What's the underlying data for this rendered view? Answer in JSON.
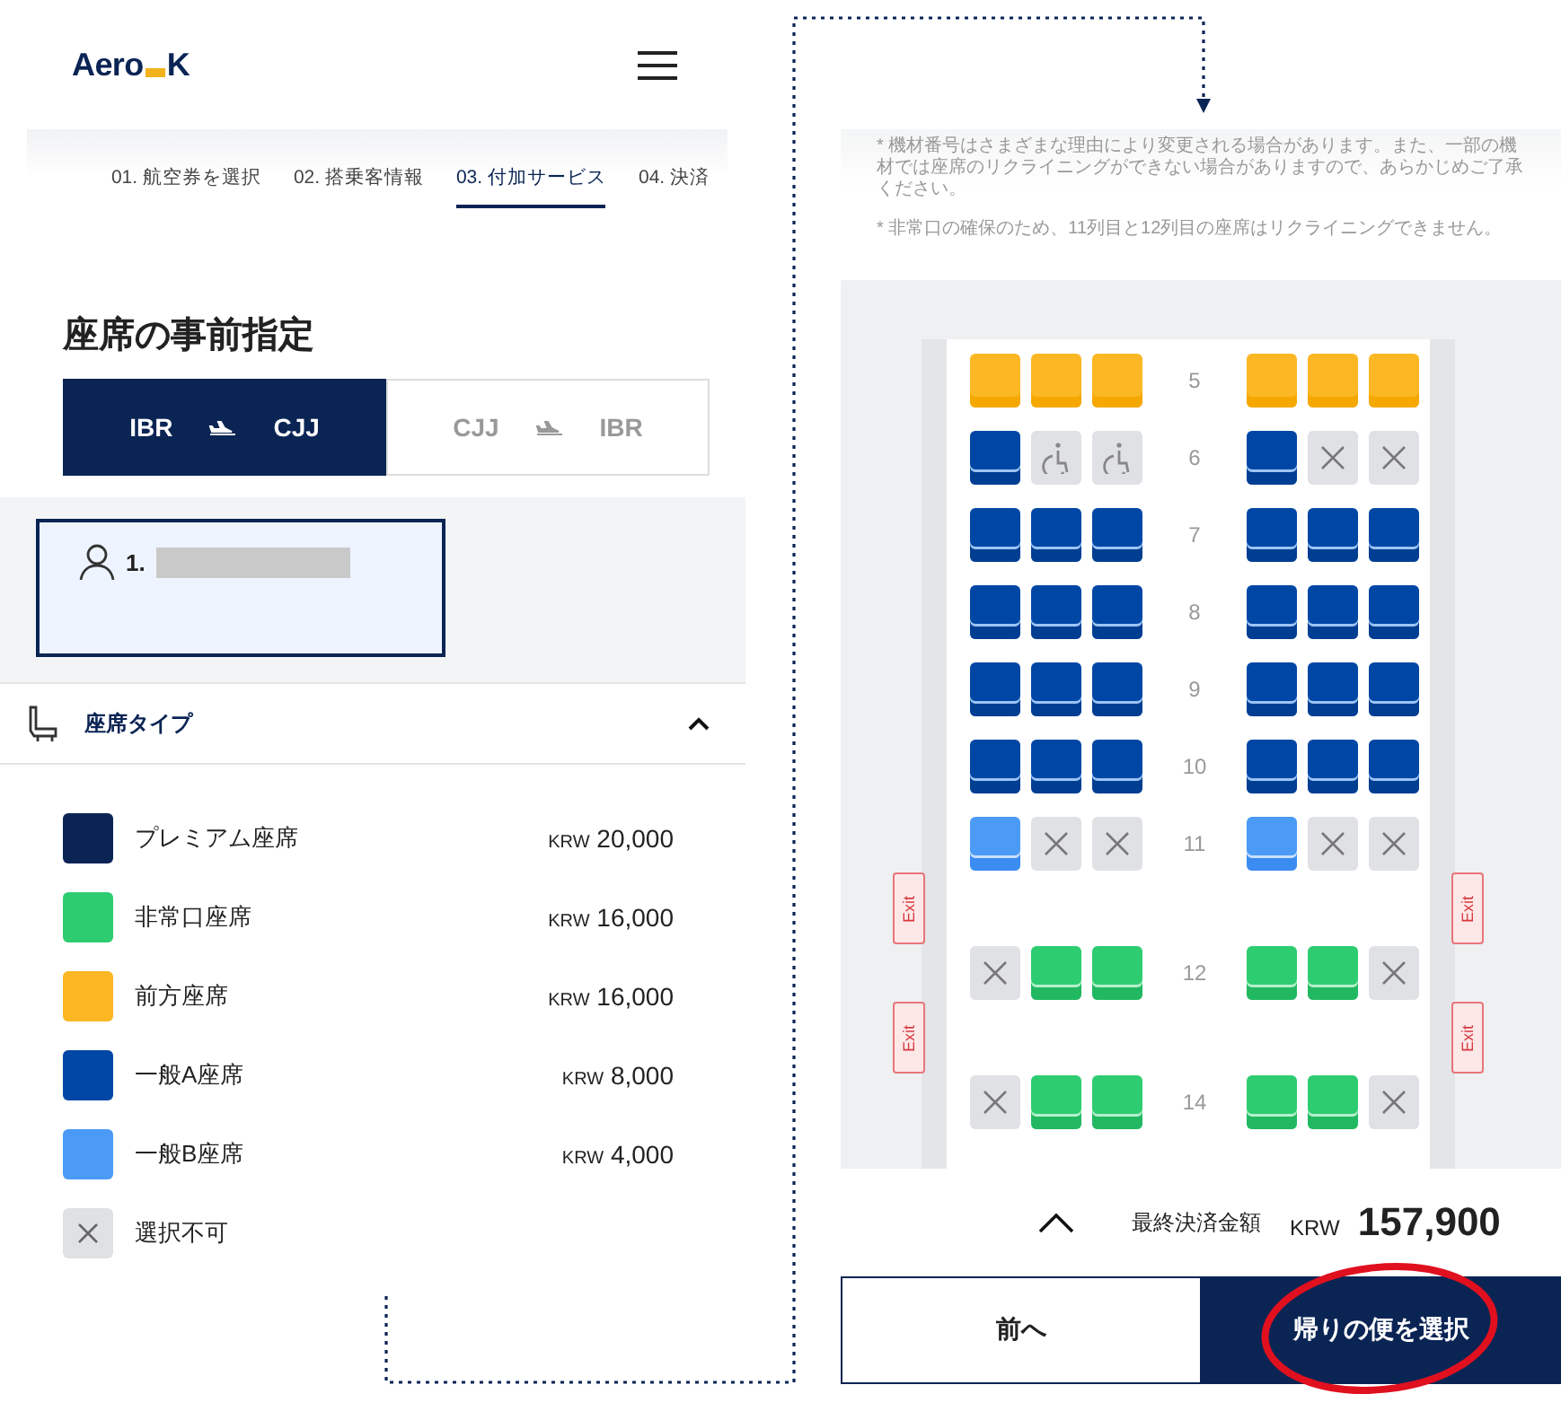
{
  "header": {
    "logo_left": "Aero",
    "logo_right": "K"
  },
  "steps": [
    {
      "label": "01. 航空券を選択",
      "selected": false
    },
    {
      "label": "02. 搭乗客情報",
      "selected": false
    },
    {
      "label": "03. 付加サービス",
      "selected": true
    },
    {
      "label": "04. 決済",
      "selected": false
    }
  ],
  "title": "座席の事前指定",
  "routes": [
    {
      "from": "IBR",
      "to": "CJJ",
      "selected": true
    },
    {
      "from": "CJJ",
      "to": "IBR",
      "selected": false
    }
  ],
  "passenger": {
    "label": "1.",
    "selected": true
  },
  "seat_type_section": {
    "title": "座席タイプ",
    "expanded": true
  },
  "legend": [
    {
      "kind": "seat",
      "color": "#0a2454",
      "label": "プレミアム座席",
      "currency": "KRW",
      "price": "20,000"
    },
    {
      "kind": "seat",
      "color": "#2ecc71",
      "label": "非常口座席",
      "currency": "KRW",
      "price": "16,000"
    },
    {
      "kind": "seat",
      "color": "#fbb724",
      "label": "前方座席",
      "currency": "KRW",
      "price": "16,000"
    },
    {
      "kind": "seat",
      "color": "#0047a5",
      "label": "一般A座席",
      "currency": "KRW",
      "price": "8,000"
    },
    {
      "kind": "seat",
      "color": "#4b9bf6",
      "label": "一般B座席",
      "currency": "KRW",
      "price": "4,000"
    },
    {
      "kind": "unavailable",
      "color": "#dfe1e5",
      "label": "選択不可"
    }
  ],
  "notes": [
    "* 機材番号はさまざまな理由により変更される場合があります。また、一部の機材では座席のリクライニングができない場合がありますので、あらかじめご了承ください。",
    "* 非常口の確保のため、11列目と12列目の座席はリクライニングできません。"
  ],
  "seat_rows": [
    {
      "kind": "seats",
      "label": "5",
      "seats": [
        {
          "kind": "front"
        },
        {
          "kind": "front"
        },
        {
          "kind": "front"
        },
        {
          "kind": "front"
        },
        {
          "kind": "front"
        },
        {
          "kind": "front"
        }
      ]
    },
    {
      "kind": "seats",
      "label": "6",
      "seats": [
        {
          "kind": "a"
        },
        {
          "kind": "wheelchair"
        },
        {
          "kind": "wheelchair"
        },
        {
          "kind": "a"
        },
        {
          "kind": "none"
        },
        {
          "kind": "none"
        }
      ]
    },
    {
      "kind": "seats",
      "label": "7",
      "seats": [
        {
          "kind": "a"
        },
        {
          "kind": "a"
        },
        {
          "kind": "a"
        },
        {
          "kind": "a"
        },
        {
          "kind": "a"
        },
        {
          "kind": "a"
        }
      ]
    },
    {
      "kind": "seats",
      "label": "8",
      "seats": [
        {
          "kind": "a"
        },
        {
          "kind": "a"
        },
        {
          "kind": "a"
        },
        {
          "kind": "a"
        },
        {
          "kind": "a"
        },
        {
          "kind": "a"
        }
      ]
    },
    {
      "kind": "seats",
      "label": "9",
      "seats": [
        {
          "kind": "a"
        },
        {
          "kind": "a"
        },
        {
          "kind": "a"
        },
        {
          "kind": "a"
        },
        {
          "kind": "a"
        },
        {
          "kind": "a"
        }
      ]
    },
    {
      "kind": "seats",
      "label": "10",
      "seats": [
        {
          "kind": "a"
        },
        {
          "kind": "a"
        },
        {
          "kind": "a"
        },
        {
          "kind": "a"
        },
        {
          "kind": "a"
        },
        {
          "kind": "a"
        }
      ]
    },
    {
      "kind": "seats",
      "label": "11",
      "seats": [
        {
          "kind": "b"
        },
        {
          "kind": "none"
        },
        {
          "kind": "none"
        },
        {
          "kind": "b"
        },
        {
          "kind": "none"
        },
        {
          "kind": "none"
        }
      ]
    },
    {
      "kind": "exit",
      "left": "Exit",
      "right": "Exit"
    },
    {
      "kind": "seats",
      "label": "12",
      "seats": [
        {
          "kind": "none"
        },
        {
          "kind": "exit"
        },
        {
          "kind": "exit"
        },
        {
          "kind": "exit"
        },
        {
          "kind": "exit"
        },
        {
          "kind": "none"
        }
      ]
    },
    {
      "kind": "exit",
      "left": "Exit",
      "right": "Exit"
    },
    {
      "kind": "seats",
      "label": "14",
      "seats": [
        {
          "kind": "none"
        },
        {
          "kind": "exit"
        },
        {
          "kind": "exit"
        },
        {
          "kind": "exit"
        },
        {
          "kind": "exit"
        },
        {
          "kind": "none"
        }
      ]
    }
  ],
  "total": {
    "label": "最終決済金額",
    "currency": "KRW",
    "amount": "157,900",
    "expanded": false
  },
  "buttons": [
    {
      "kind": "secondary",
      "label": "前へ"
    },
    {
      "kind": "primary",
      "label": "帰りの便を選択"
    }
  ]
}
